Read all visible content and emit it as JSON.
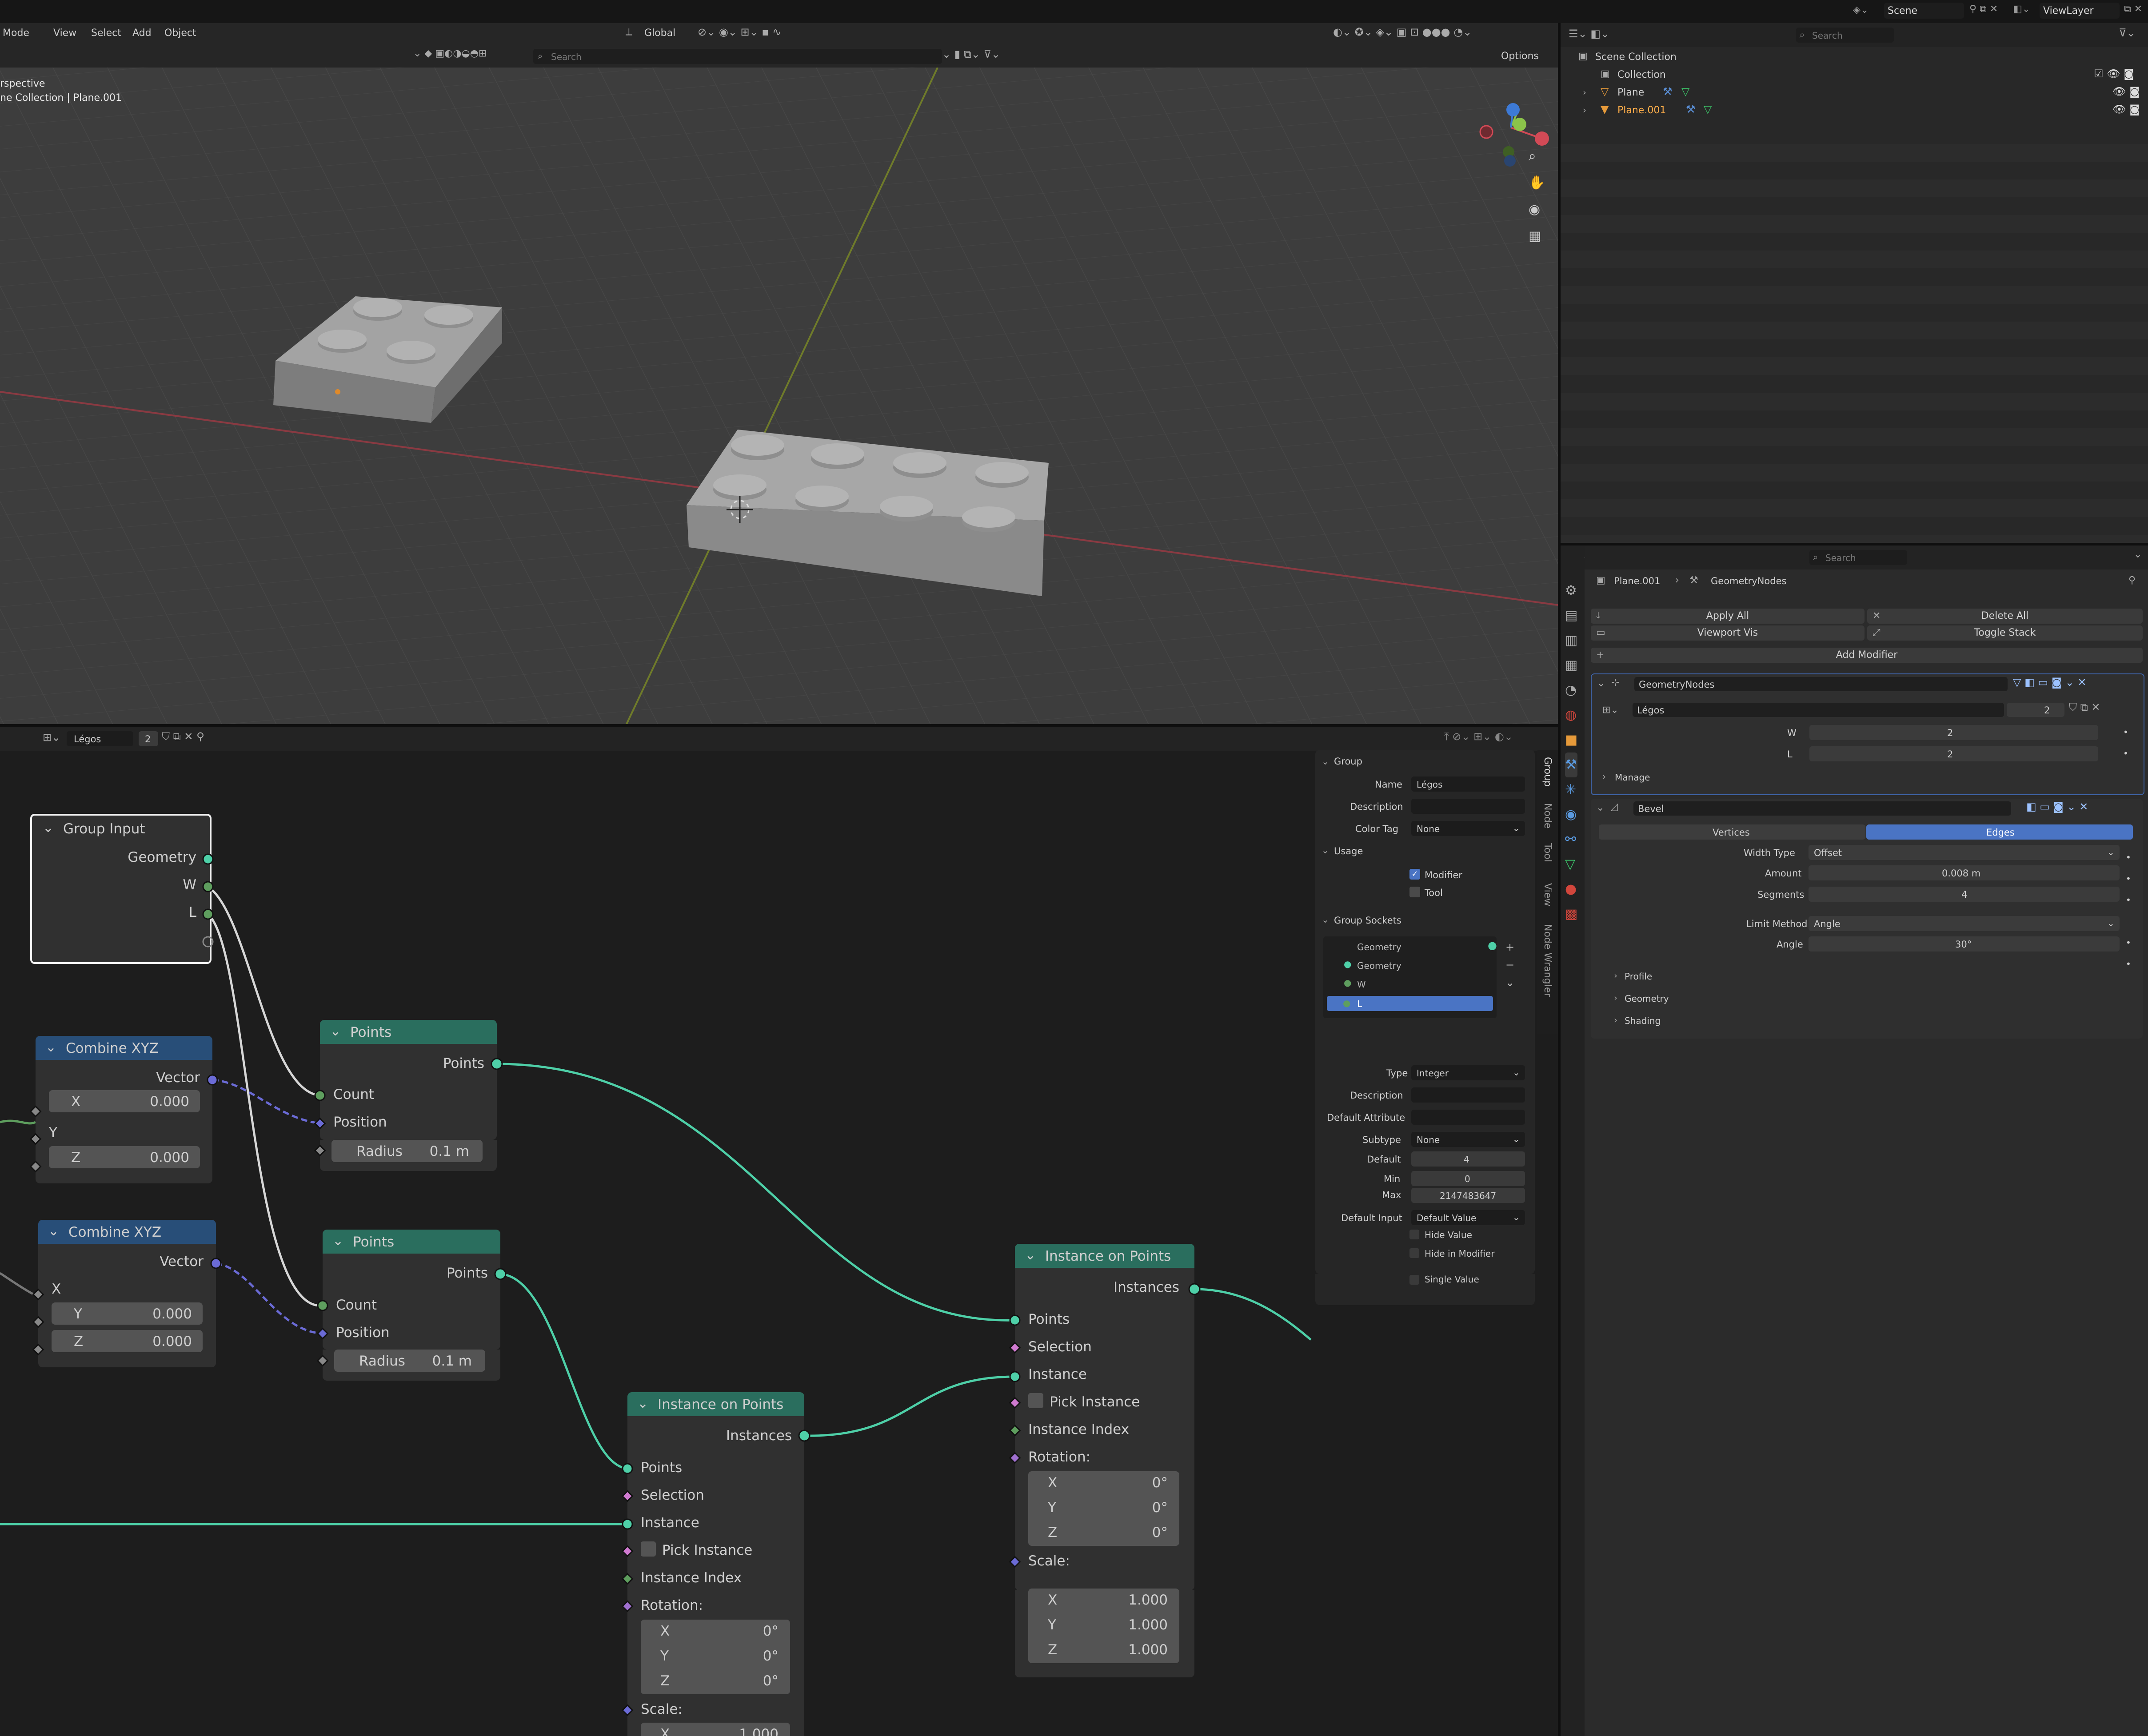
{
  "colors": {
    "link_geometry": "#4ed0a8",
    "link_vector": "#6b6bd6",
    "link_int": "#5e9e5e",
    "header_geometry": "#2a6e5e",
    "header_vector": "#284e78",
    "accent": "#4a74c4"
  },
  "topbar": {
    "scene": "Scene",
    "view_layer": "ViewLayer"
  },
  "viewport": {
    "mode": "Mode",
    "menus": [
      "View",
      "Select",
      "Add",
      "Object"
    ],
    "transform": "Global",
    "search_placeholder": "Search",
    "options": "Options",
    "info_line1": "rspective",
    "info_line2": "ne Collection | Plane.001"
  },
  "outliner": {
    "search_placeholder": "Search",
    "root": "Scene Collection",
    "items": [
      {
        "label": "Collection"
      },
      {
        "label": "Plane"
      },
      {
        "label": "Plane.001"
      }
    ]
  },
  "node_editor": {
    "tree_name": "Légos",
    "users": "2",
    "nodes": {
      "group_input": {
        "title": "Group Input",
        "sockets": [
          "Geometry",
          "W",
          "L"
        ]
      },
      "combine1": {
        "title": "Combine XYZ",
        "out": "Vector",
        "x_label": "X",
        "x": "0.000",
        "y_label": "Y",
        "z_label": "Z",
        "z": "0.000"
      },
      "combine2": {
        "title": "Combine XYZ",
        "out": "Vector",
        "x_label": "X",
        "y_label": "Y",
        "y": "0.000",
        "z_label": "Z",
        "z": "0.000"
      },
      "points1": {
        "title": "Points",
        "out": "Points",
        "count": "Count",
        "position": "Position",
        "radius_label": "Radius",
        "radius": "0.1 m"
      },
      "points2": {
        "title": "Points",
        "out": "Points",
        "count": "Count",
        "position": "Position",
        "radius_label": "Radius",
        "radius": "0.1 m"
      },
      "iop1": {
        "title": "Instance on Points",
        "out": "Instances",
        "inputs": [
          "Points",
          "Selection",
          "Instance",
          "Pick Instance",
          "Instance Index",
          "Rotation:"
        ],
        "rot": [
          {
            "l": "X",
            "v": "0°"
          },
          {
            "l": "Y",
            "v": "0°"
          },
          {
            "l": "Z",
            "v": "0°"
          }
        ],
        "scale_label": "Scale:",
        "scale_x_label": "X",
        "scale_x": "1.000"
      },
      "iop2": {
        "title": "Instance on Points",
        "out": "Instances",
        "inputs": [
          "Points",
          "Selection",
          "Instance",
          "Pick Instance",
          "Instance Index",
          "Rotation:"
        ],
        "rot": [
          {
            "l": "X",
            "v": "0°"
          },
          {
            "l": "Y",
            "v": "0°"
          },
          {
            "l": "Z",
            "v": "0°"
          }
        ],
        "scale_label": "Scale:",
        "scale": [
          {
            "l": "X",
            "v": "1.000"
          },
          {
            "l": "Y",
            "v": "1.000"
          },
          {
            "l": "Z",
            "v": "1.000"
          }
        ]
      }
    },
    "tabs": [
      "Group",
      "Node",
      "Tool",
      "View",
      "Node Wrangler"
    ]
  },
  "npanel": {
    "group_header": "Group",
    "name_label": "Name",
    "name_value": "Légos",
    "description_label": "Description",
    "color_tag_label": "Color Tag",
    "color_tag_value": "None",
    "usage_header": "Usage",
    "modifier_label": "Modifier",
    "tool_label": "Tool",
    "sockets_header": "Group Sockets",
    "sockets": [
      "Geometry",
      "Geometry",
      "W",
      "L"
    ],
    "type_label": "Type",
    "type_value": "Integer",
    "desc_label": "Description",
    "default_attr_label": "Default Attribute",
    "subtype_label": "Subtype",
    "subtype_value": "None",
    "default_label": "Default",
    "default_value": "4",
    "min_label": "Min",
    "min_value": "0",
    "max_label": "Max",
    "max_value": "2147483647",
    "default_input_label": "Default Input",
    "default_input_value": "Default Value",
    "hide_value": "Hide Value",
    "hide_in_modifier": "Hide in Modifier",
    "single_value": "Single Value"
  },
  "properties": {
    "search_placeholder": "Search",
    "breadcrumb_obj": "Plane.001",
    "breadcrumb_mod": "GeometryNodes",
    "apply_all": "Apply All",
    "delete_all": "Delete All",
    "viewport_vis": "Viewport Vis",
    "toggle_stack": "Toggle Stack",
    "add_modifier": "Add Modifier",
    "gn": {
      "name": "GeometryNodes",
      "tree": "Légos",
      "users": "2",
      "w_label": "W",
      "w": "2",
      "l_label": "L",
      "l": "2",
      "manage": "Manage"
    },
    "bevel": {
      "name": "Bevel",
      "vertices": "Vertices",
      "edges": "Edges",
      "width_type_label": "Width Type",
      "width_type": "Offset",
      "amount_label": "Amount",
      "amount": "0.008 m",
      "segments_label": "Segments",
      "segments": "4",
      "limit_label": "Limit Method",
      "limit": "Angle",
      "angle_label": "Angle",
      "angle": "30°",
      "profile": "Profile",
      "geometry": "Geometry",
      "shading": "Shading"
    }
  }
}
